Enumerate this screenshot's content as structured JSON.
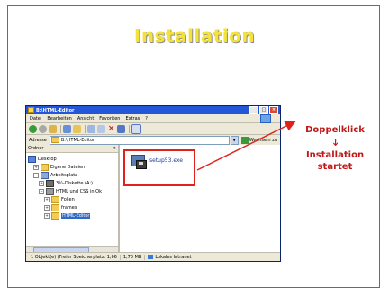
{
  "slide": {
    "title": "Installation"
  },
  "window": {
    "title": "B:\\HTML-Editor",
    "menu": [
      "Datei",
      "Bearbeiten",
      "Ansicht",
      "Favoriten",
      "Extras",
      "?"
    ],
    "address_label": "Adresse",
    "address_value": "B:\\HTML-Editor",
    "go_label": "Wechseln zu",
    "folders_label": "Ordner",
    "tree": [
      {
        "label": "Desktop",
        "icon": "desktop"
      },
      {
        "label": "Eigene Dateien",
        "icon": "folder"
      },
      {
        "label": "Arbeitsplatz",
        "icon": "pc"
      },
      {
        "label": "3½-Diskette (A:)",
        "icon": "floppy"
      },
      {
        "label": "HTML und CSS in Ok",
        "icon": "net"
      },
      {
        "label": "Folien",
        "icon": "folder"
      },
      {
        "label": "frames",
        "icon": "folder"
      },
      {
        "label": "HTML-Editor",
        "icon": "folder",
        "selected": true
      }
    ],
    "file": "setup53.exe",
    "status": {
      "objects": "1 Objekt(e) (Freier Speicherplatz: 1,66",
      "size": "1,70 MB",
      "zone": "Lokales Intranet"
    }
  },
  "annotation": {
    "doppelklick": "Doppelklick",
    "arrow_down": "➔",
    "installation_line1": "Installation",
    "installation_line2": "startet",
    "color": "#c01818"
  }
}
